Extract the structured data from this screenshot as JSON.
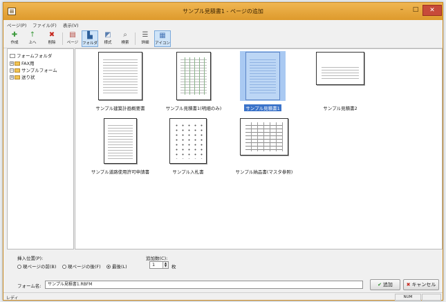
{
  "window": {
    "title": "サンプル見積書1 - ページの追加"
  },
  "titlebar_buttons": {
    "minimize": "–",
    "maximize": "□",
    "close": "✕"
  },
  "menu": [
    "ページ(P)",
    "ファイル(F)",
    "表示(V)"
  ],
  "toolbar": [
    {
      "label": "作成",
      "icon": "new-doc-icon",
      "glyph": "✚"
    },
    {
      "label": "上へ",
      "icon": "up-folder-icon",
      "glyph": "↑"
    },
    {
      "label": "削除",
      "icon": "delete-icon",
      "glyph": "✖"
    },
    {
      "label": "ページ",
      "icon": "page-icon",
      "glyph": "▤"
    },
    {
      "label": "フォルダ",
      "icon": "folder-icon",
      "glyph": "▙"
    },
    {
      "label": "様式",
      "icon": "style-icon",
      "glyph": "◩"
    },
    {
      "label": "検索",
      "icon": "search-icon",
      "glyph": "⌕"
    },
    {
      "label": "詳細",
      "icon": "details-view-icon",
      "glyph": "☰"
    },
    {
      "label": "アイコン",
      "icon": "icon-view-icon",
      "glyph": "▦"
    }
  ],
  "tree": [
    {
      "label": "フォームフォルダ",
      "expander": ""
    },
    {
      "label": "FAX用",
      "expander": "+"
    },
    {
      "label": "サンプルフォーム",
      "expander": "−"
    },
    {
      "label": "送り状",
      "expander": "+"
    }
  ],
  "forms": [
    {
      "name": "サンプル建築計画概要書",
      "style": "lines",
      "selected": false
    },
    {
      "name": "サンプル見積書1(明細のみ)",
      "style": "grid",
      "selected": false
    },
    {
      "name": "サンプル見積書1",
      "style": "lines",
      "selected": true
    },
    {
      "name": "サンプル見積書2",
      "style": "wide",
      "selected": false
    },
    {
      "name": "サンプル道路使用許可申請書",
      "style": "lines",
      "selected": false
    },
    {
      "name": "サンプル入札書",
      "style": "sparse",
      "selected": false
    },
    {
      "name": "サンプル納品書(マスタ参照)",
      "style": "table",
      "selected": false
    }
  ],
  "insert": {
    "label": "挿入位置(P):",
    "options": [
      "現ページの前(B)",
      "現ページの後(F)",
      "最後(L)"
    ],
    "selected_index": 2
  },
  "add_count": {
    "label": "追加数(C):",
    "value": "1",
    "unit": "枚"
  },
  "form_name": {
    "label": "フォーム名:",
    "value": "サンプル見積書1.RBFM"
  },
  "buttons": {
    "add": "追加",
    "add_icon": "✔",
    "cancel": "キャンセル",
    "cancel_icon": "✖"
  },
  "status": {
    "text": "レディ",
    "num": "NUM"
  }
}
